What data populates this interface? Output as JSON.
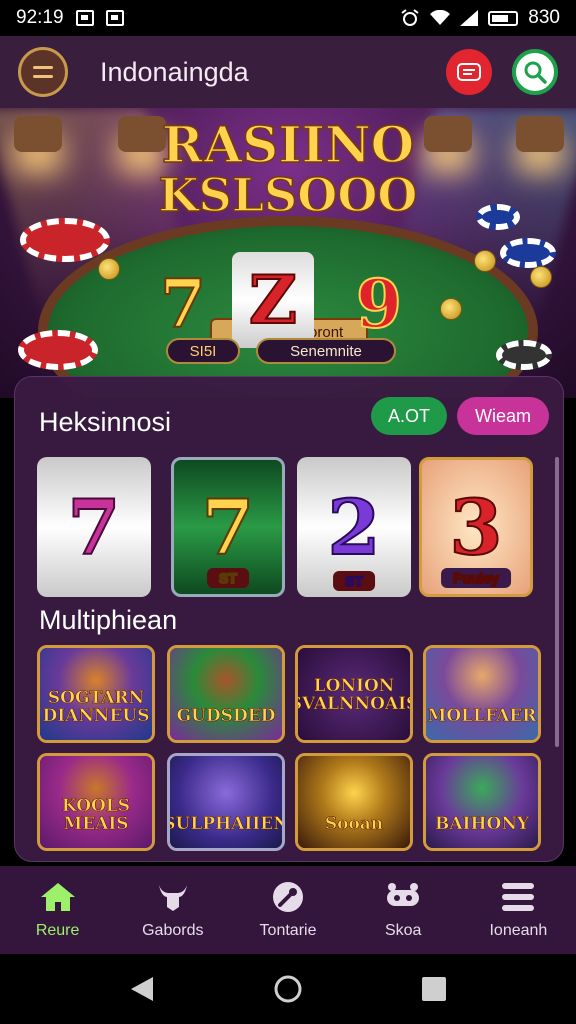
{
  "status_bar": {
    "time": "92:19",
    "battery": "830"
  },
  "header": {
    "title": "Indonaingda",
    "menu_icon": "hamburger-menu-icon",
    "right_icons": [
      "chat-icon",
      "search-icon"
    ]
  },
  "banner": {
    "title_line1": "RASIINO",
    "title_line2": "KSLSOOO",
    "subtitle": "Asudon Cooront",
    "reels": [
      "7",
      "Z",
      "9"
    ],
    "pill_left": "SI5I",
    "pill_right": "Senemnite"
  },
  "panel": {
    "section1_title": "Heksinnosi",
    "tab1": "A.OT",
    "tab2": "Wieam",
    "slots": [
      {
        "symbol": "7",
        "tag": ""
      },
      {
        "symbol": "7",
        "tag": "ST"
      },
      {
        "symbol": "2",
        "tag": "ST"
      },
      {
        "symbol": "3",
        "tag": "Puuley"
      }
    ],
    "section2_title": "Multiphiean",
    "games": [
      {
        "title": "SOGTARN DIANNEUS"
      },
      {
        "title": "GUDSDED"
      },
      {
        "title": "LONION SVALNNOAIS"
      },
      {
        "title": "MOLLFAER"
      },
      {
        "title": "KOOLS MEAIS"
      },
      {
        "title": "SULPHAIIEN"
      },
      {
        "title": "Sooan"
      },
      {
        "title": "BAIHONY"
      }
    ]
  },
  "bottom_nav": [
    {
      "label": "Reure",
      "icon": "home-icon",
      "active": true
    },
    {
      "label": "Gabords",
      "icon": "bull-icon",
      "active": false
    },
    {
      "label": "Tontarie",
      "icon": "wrench-icon",
      "active": false
    },
    {
      "label": "Skoa",
      "icon": "controller-icon",
      "active": false
    },
    {
      "label": "Ioneanh",
      "icon": "list-icon",
      "active": false
    }
  ],
  "colors": {
    "accent_green": "#1da14b",
    "accent_magenta": "#c8339a",
    "nav_active": "#9cf06a",
    "header_bg": "#3a1e3e"
  }
}
